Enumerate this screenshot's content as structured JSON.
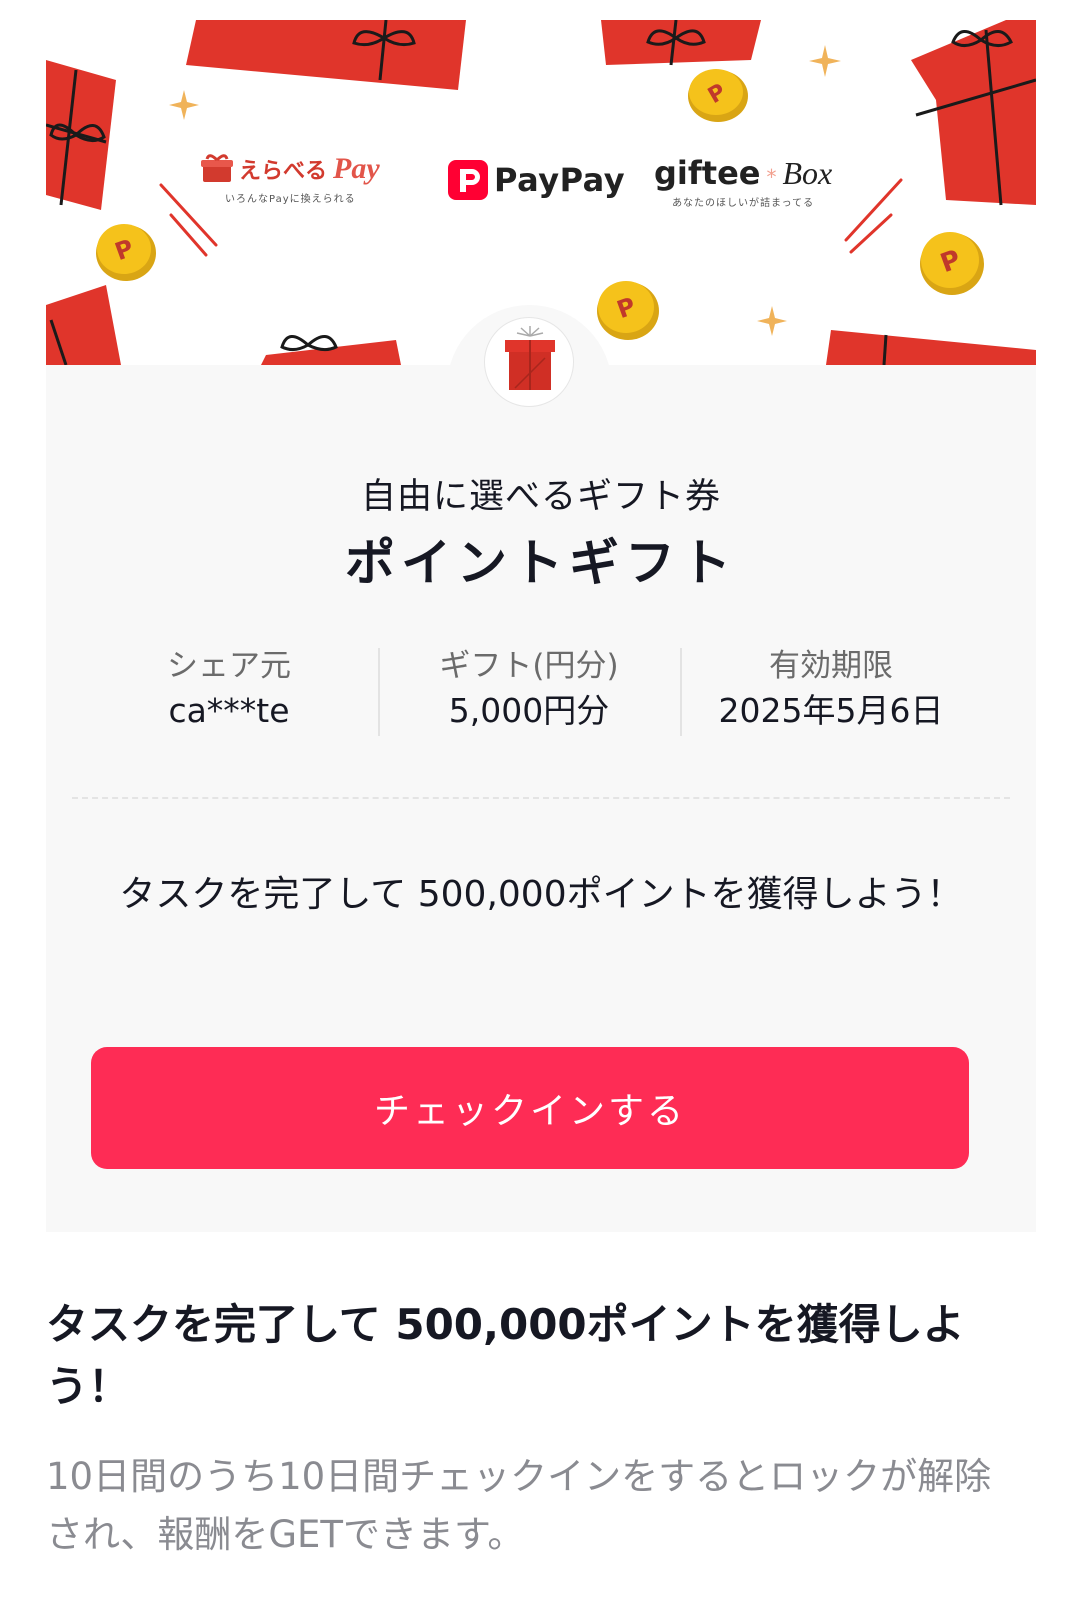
{
  "banner": {
    "brands": {
      "erabel": {
        "name": "えらべる",
        "pay": "Pay",
        "tagline": "いろんなPayに換えられる"
      },
      "paypay": {
        "name": "PayPay"
      },
      "giftee": {
        "name": "giftee",
        "box": "Box",
        "tagline": "あなたのほしいが詰まってる"
      }
    },
    "icons": [
      "gift-box-icon",
      "coin-icon",
      "sparkle-icon"
    ]
  },
  "gift": {
    "subtitle": "自由に選べるギフト券",
    "title": "ポイントギフト"
  },
  "info": [
    {
      "label": "シェア元",
      "value": "ca***te"
    },
    {
      "label": "ギフト(円分)",
      "value": "5,000円分"
    },
    {
      "label": "有効期限",
      "value": "2025年5月6日"
    }
  ],
  "card_task_text": "タスクを完了して 500,000ポイントを獲得しよう！",
  "checkin_button": "チェックインする",
  "section": {
    "title": "タスクを完了して 500,000ポイントを獲得しよう！",
    "description": "10日間のうち10日間チェックインをするとロックが解除され、報酬をGETできます。"
  },
  "colors": {
    "accent": "#fe2c55",
    "gift_red": "#e0352b",
    "coin_gold": "#f5c21b",
    "paypay_red": "#ff0033"
  }
}
